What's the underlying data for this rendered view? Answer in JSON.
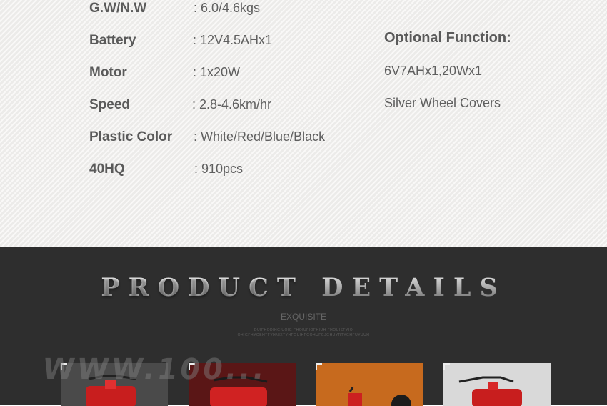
{
  "specs": {
    "rows": [
      {
        "label": "G.W/N.W",
        "value": ": 6.0/4.6kgs"
      },
      {
        "label": "Battery",
        "value": ": 12V4.5AHx1"
      },
      {
        "label": "Motor",
        "value": ": 1x20W"
      },
      {
        "label": "Speed",
        "value": ": 2.8-4.6km/hr"
      },
      {
        "label": "Plastic Color",
        "value": ": White/Red/Blue/Black"
      },
      {
        "label": "40HQ",
        "value": ": 910pcs"
      }
    ],
    "optional": {
      "title": "Optional Function:",
      "items": [
        "6V7AHx1,20Wx1",
        "Silver Wheel Covers"
      ]
    }
  },
  "details": {
    "title_word1": "PRODUCT",
    "title_word2": "DETAILS",
    "subtitle": "EXQUISITE",
    "fine_line1": "DUIFHODIHGIUOIG FHOIUFIOFHIUH FHOUISFYIO",
    "fine_line2": "OHIGFHYGBHTFYHNIXTYHFGUIHFGOHUFGJGHUYRTYGHFUYUUH",
    "watermark": "WWW.100...",
    "thumbnails": [
      {
        "bg": "#4a4a4a"
      },
      {
        "bg": "#5a1616"
      },
      {
        "bg": "#c76a1e"
      },
      {
        "bg": "#d9d9d9"
      }
    ]
  }
}
